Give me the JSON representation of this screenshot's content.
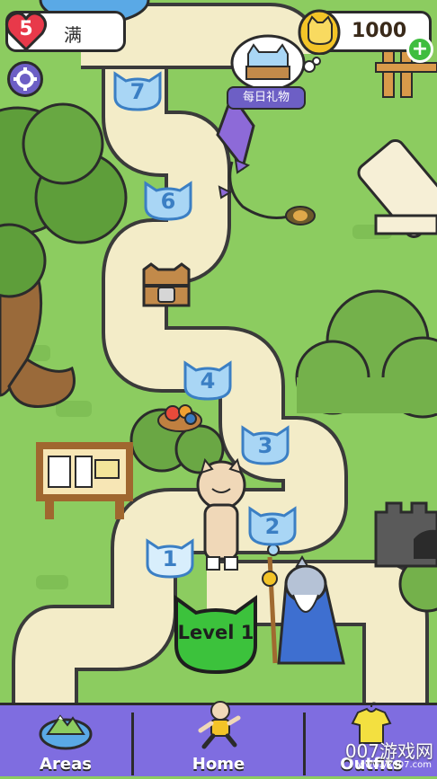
{
  "hud": {
    "lives_count": "5",
    "lives_status": "满",
    "coins": "1000",
    "add_coins_label": "+",
    "daily_gift_label": "每日礼物"
  },
  "map": {
    "level_nodes": [
      "7",
      "6",
      "4",
      "3",
      "2",
      "1"
    ],
    "current_level_label": "Level 1"
  },
  "nav": {
    "areas_label": "Areas",
    "home_label": "Home",
    "outfits_label": "Outfits"
  },
  "watermark": {
    "text": "007游戏网",
    "url": "www.yx007.com"
  },
  "colors": {
    "grass": "#8ccc60",
    "path": "#f3ecc8",
    "accent_purple": "#7f6de0",
    "level_green": "#3cc23c",
    "node_blue": "#a9d6f5",
    "heart_red": "#e8394a",
    "coin_gold": "#f3c427"
  },
  "icons": [
    "heart-icon",
    "gear-icon",
    "coin-icon",
    "gift-cat-icon",
    "locked-chest-icon",
    "kite-icon",
    "areas-globe-icon",
    "home-runner-icon",
    "outfits-shirt-icon"
  ]
}
